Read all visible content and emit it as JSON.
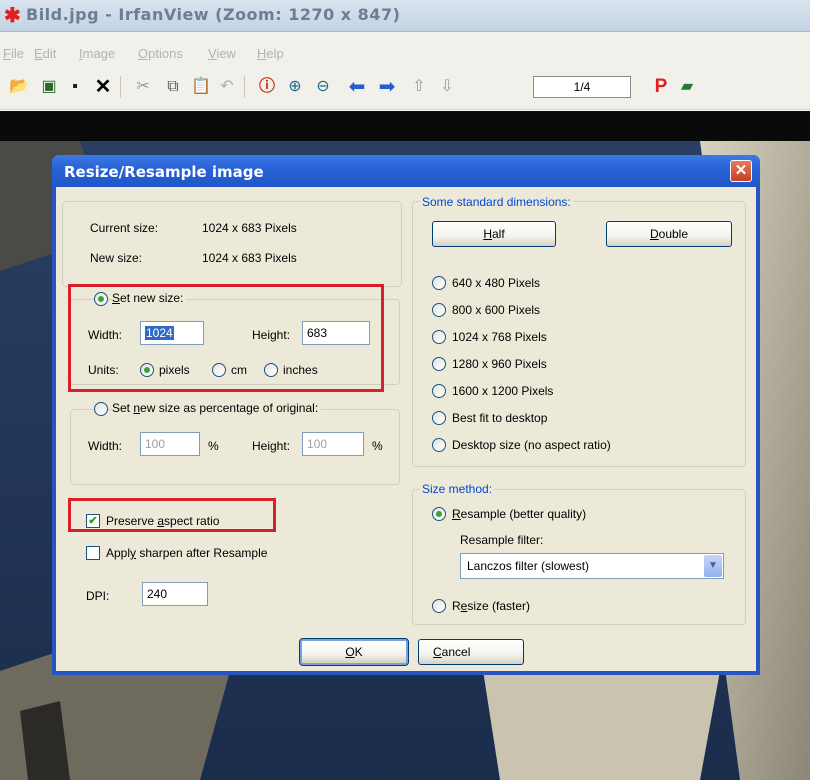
{
  "window": {
    "title": "Bild.jpg - IrfanView (Zoom: 1270 x 847)"
  },
  "menu": [
    {
      "label": "File",
      "u": "F",
      "rest": "ile"
    },
    {
      "label": "Edit",
      "u": "E",
      "rest": "dit"
    },
    {
      "label": "Image",
      "u": "I",
      "rest": "mage"
    },
    {
      "label": "Options",
      "u": "O",
      "rest": "ptions"
    },
    {
      "label": "View",
      "u": "V",
      "rest": "iew"
    },
    {
      "label": "Help",
      "u": "H",
      "rest": "elp"
    }
  ],
  "toolbar": {
    "page_indicator": "1/4"
  },
  "dialog": {
    "title": "Resize/Resample image",
    "current_size_label": "Current size:",
    "current_size_value": "1024  x  683  Pixels",
    "new_size_label": "New size:",
    "new_size_value": "1024  x  683  Pixels",
    "set_new_size": {
      "label": "Set new size:",
      "selected": true
    },
    "width_label": "Width:",
    "width_value": "1024",
    "height_label": "Height:",
    "height_value": "683",
    "units_label": "Units:",
    "units": [
      {
        "label": "pixels",
        "selected": true
      },
      {
        "label": "cm",
        "selected": false
      },
      {
        "label": "inches",
        "selected": false
      }
    ],
    "percent": {
      "label": "Set new size as percentage of original:",
      "width_label": "Width:",
      "width_value": "100",
      "height_label": "Height:",
      "height_value": "100",
      "unit": "%"
    },
    "preserve_aspect": {
      "label": "Preserve aspect ratio",
      "checked": true
    },
    "apply_sharpen": {
      "label": "Apply sharpen after Resample",
      "checked": false
    },
    "dpi_label": "DPI:",
    "dpi_value": "240",
    "standard": {
      "label": "Some standard dimensions:",
      "half": "Half",
      "double": "Double",
      "options": [
        "640 x 480 Pixels",
        "800 x 600 Pixels",
        "1024 x 768 Pixels",
        "1280 x 960 Pixels",
        "1600 x 1200 Pixels",
        "Best fit to desktop",
        "Desktop size (no aspect ratio)"
      ]
    },
    "method": {
      "label": "Size method:",
      "resample": "Resample (better quality)",
      "filter_label": "Resample filter:",
      "filter_value": "Lanczos filter (slowest)",
      "resize": "Resize (faster)"
    },
    "ok": "OK",
    "cancel": "Cancel"
  },
  "colors": {
    "highlight": "#d8202a",
    "title_bar": "#2a63d6",
    "dialog_bg": "#ece9d8",
    "group_label": "#0046d5"
  }
}
